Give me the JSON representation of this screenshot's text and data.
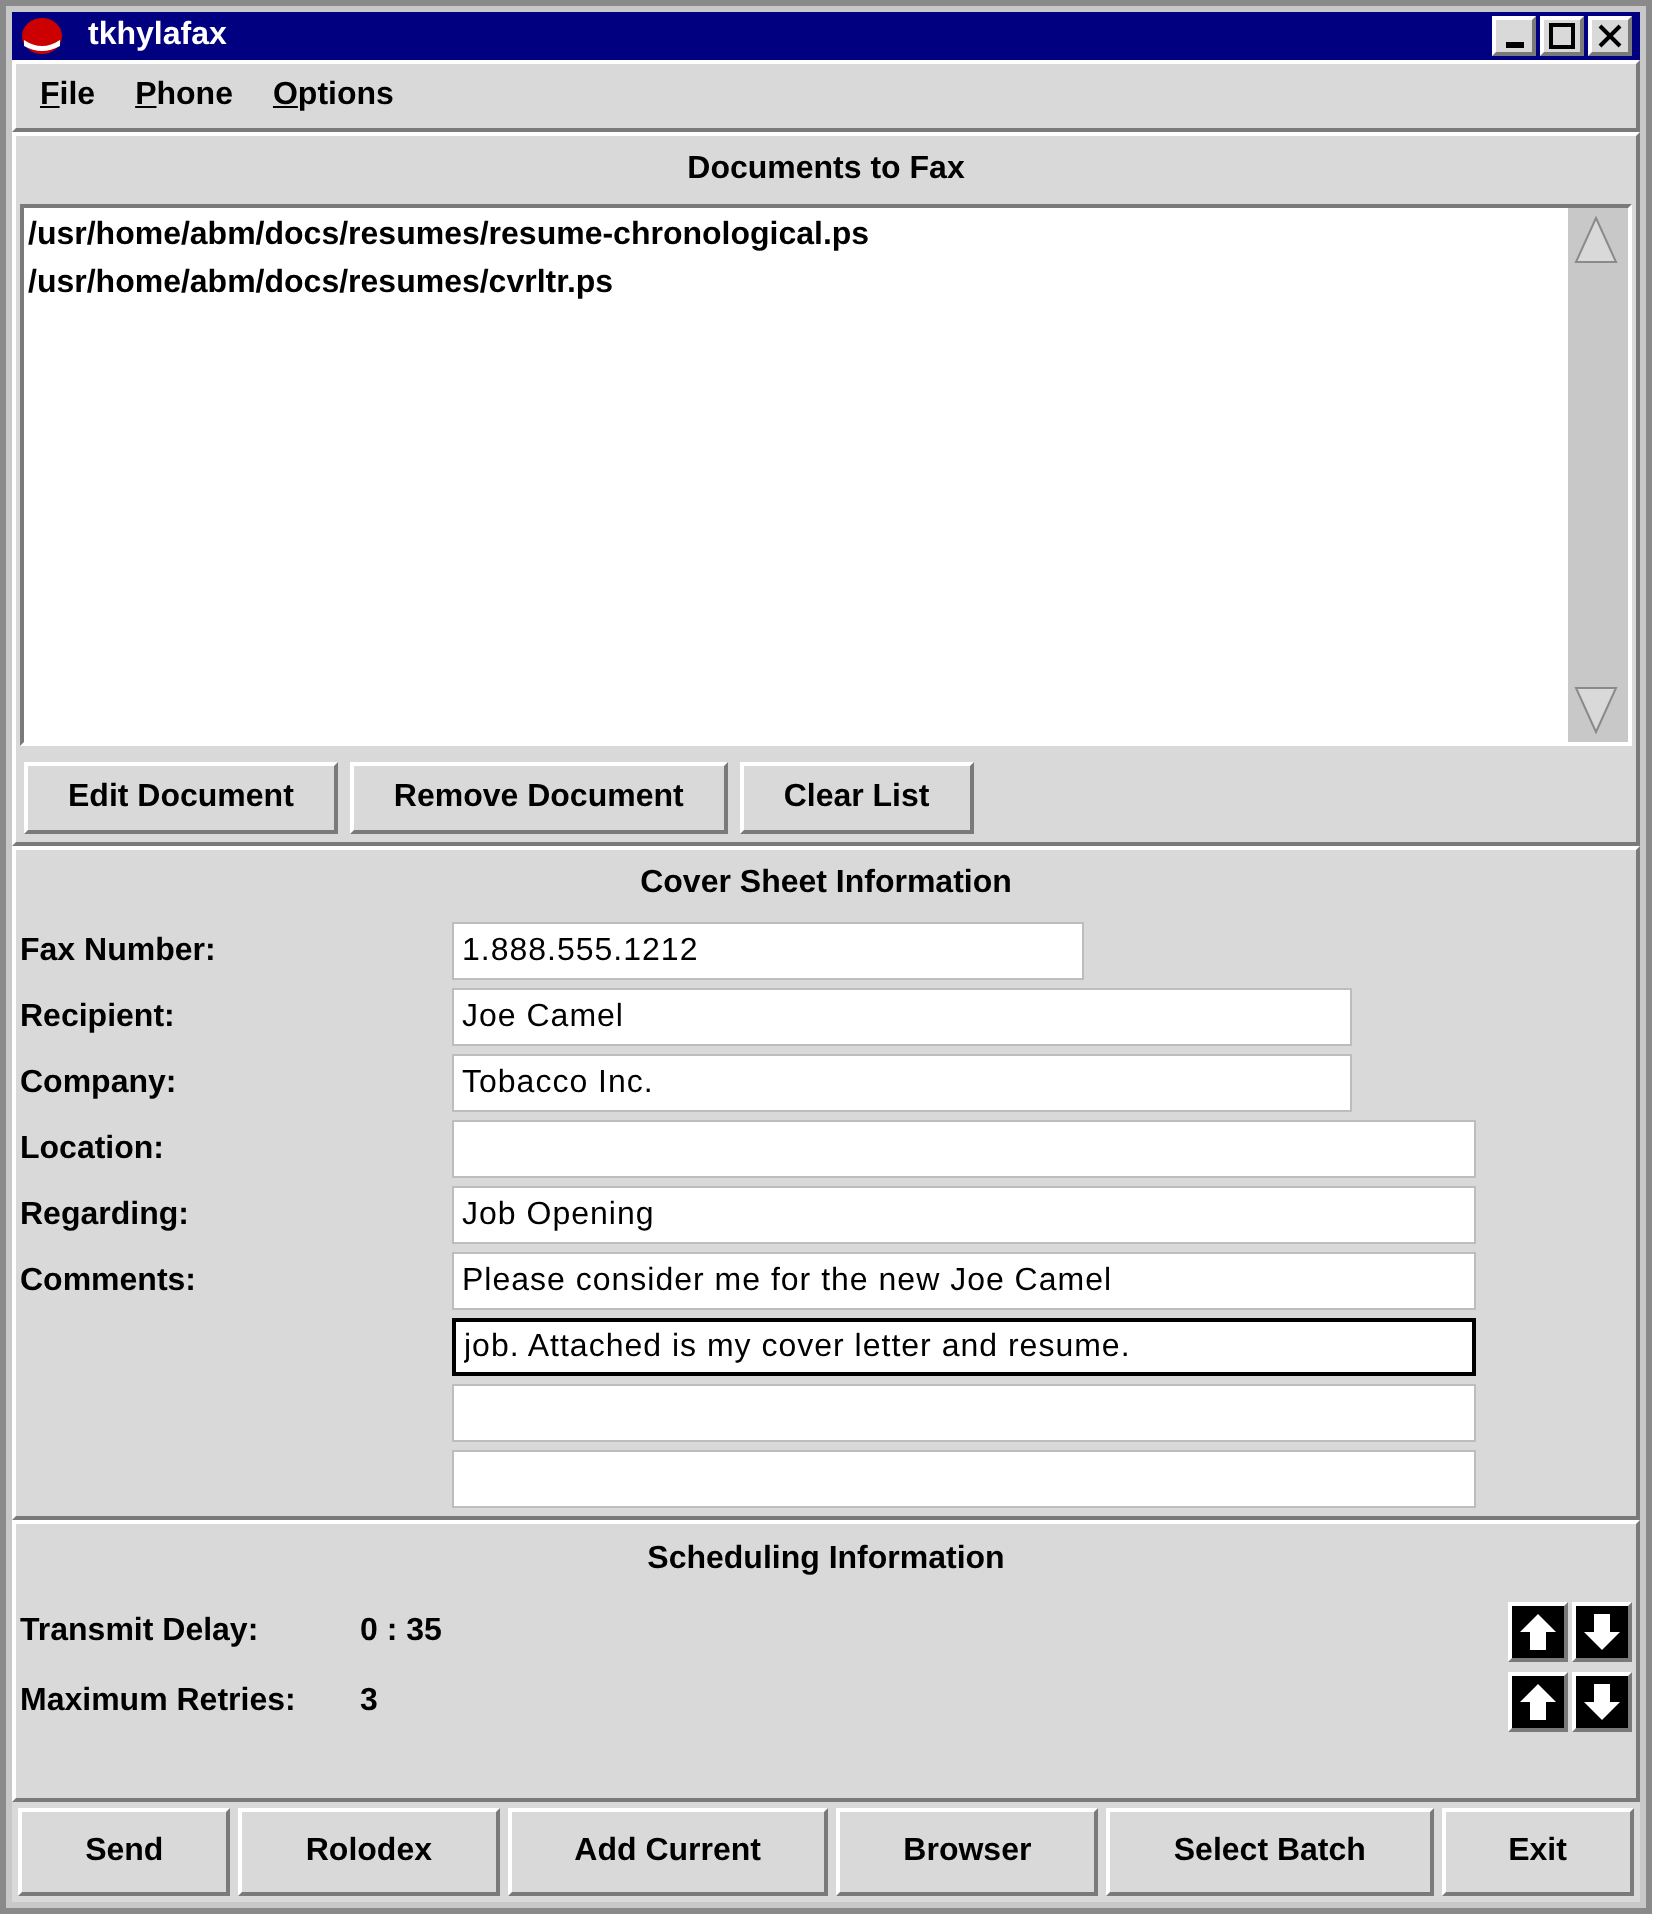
{
  "window": {
    "title": "tkhylafax"
  },
  "menu": [
    "File",
    "Phone",
    "Options"
  ],
  "documents": {
    "heading": "Documents to Fax",
    "items": [
      "/usr/home/abm/docs/resumes/resume-chronological.ps",
      "/usr/home/abm/docs/resumes/cvrltr.ps"
    ],
    "buttons": [
      "Edit Document",
      "Remove Document",
      "Clear List"
    ]
  },
  "cover": {
    "heading": "Cover Sheet Information",
    "fields": [
      {
        "label": "Fax Number:",
        "lines": [
          {
            "value": "1.888.555.1212",
            "focused": false
          }
        ]
      },
      {
        "label": "Recipient:",
        "lines": [
          {
            "value": "Joe Camel",
            "focused": false
          }
        ]
      },
      {
        "label": "Company:",
        "lines": [
          {
            "value": "Tobacco Inc.",
            "focused": false
          }
        ]
      },
      {
        "label": "Location:",
        "lines": [
          {
            "focused": false
          }
        ]
      },
      {
        "label": "Regarding:",
        "lines": [
          {
            "value": "Job Opening",
            "focused": false
          }
        ]
      },
      {
        "label": "Comments:",
        "lines": [
          {
            "value": "Please consider me for the new Joe Camel",
            "focused": false
          },
          {
            "value": "job. Attached is my cover letter and resume.",
            "focused": true
          },
          {
            "focused": false
          },
          {
            "focused": false
          }
        ]
      }
    ]
  },
  "scheduling": {
    "heading": "Scheduling Information",
    "rows": [
      {
        "label": "Transmit Delay:",
        "value": "0 : 35"
      },
      {
        "label": "Maximum Retries:",
        "value": "3"
      }
    ]
  },
  "buttons": [
    "Send",
    "Rolodex",
    "Add Current",
    "Browser",
    "Select Batch",
    "Exit"
  ]
}
